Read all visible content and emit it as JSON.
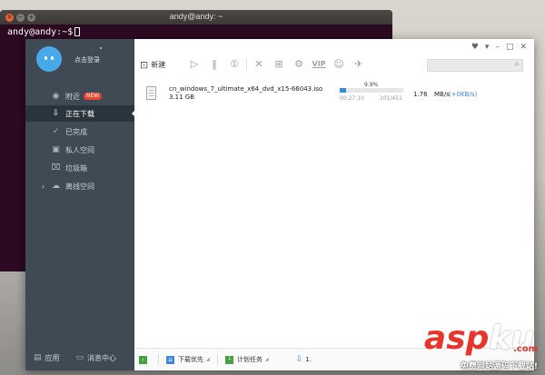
{
  "terminal": {
    "title": "andy@andy: ~",
    "prompt": "andy@andy:~$"
  },
  "sidebar": {
    "login_label": "点击登录",
    "items": [
      {
        "label": "附近",
        "icon": "location-pin-icon",
        "badge": "NEW"
      },
      {
        "label": "正在下载",
        "icon": "download-icon"
      },
      {
        "label": "已完成",
        "icon": "check-circle-icon"
      },
      {
        "label": "私人空间",
        "icon": "lock-icon"
      },
      {
        "label": "垃圾箱",
        "icon": "trash-icon"
      },
      {
        "label": "离线空间",
        "icon": "cloud-download-icon"
      }
    ],
    "bottom": {
      "apps_label": "应用",
      "messages_label": "消息中心"
    }
  },
  "toolbar": {
    "new_label": "新建",
    "vip_label": "VIP",
    "search_placeholder": ""
  },
  "download": {
    "file_name": "cn_windows_7_ultimate_x64_dvd_x15-66043.iso",
    "file_size": "3.11 GB",
    "progress": 0.099,
    "progress_text": "9.9%",
    "elapsed": "00:27:10",
    "parts": "101/451",
    "speed": "1.76",
    "speed_unit": "MB/s",
    "upload_speed": "(+0KB/s)"
  },
  "statusbar": {
    "priority_label": "下载优先",
    "plan_label": "计划任务",
    "speed_value": "1."
  },
  "watermark": {
    "text_red": "asp",
    "text_white": "ku",
    "domain": ".com",
    "subtitle": "免费网站源码下载站!"
  },
  "colors": {
    "sidebar_bg": "#3f4a54",
    "sidebar_active": "#2a343c",
    "accent_blue": "#2f8ed8",
    "terminal_bg": "#2c0a22",
    "badge_red": "#e9452f"
  }
}
